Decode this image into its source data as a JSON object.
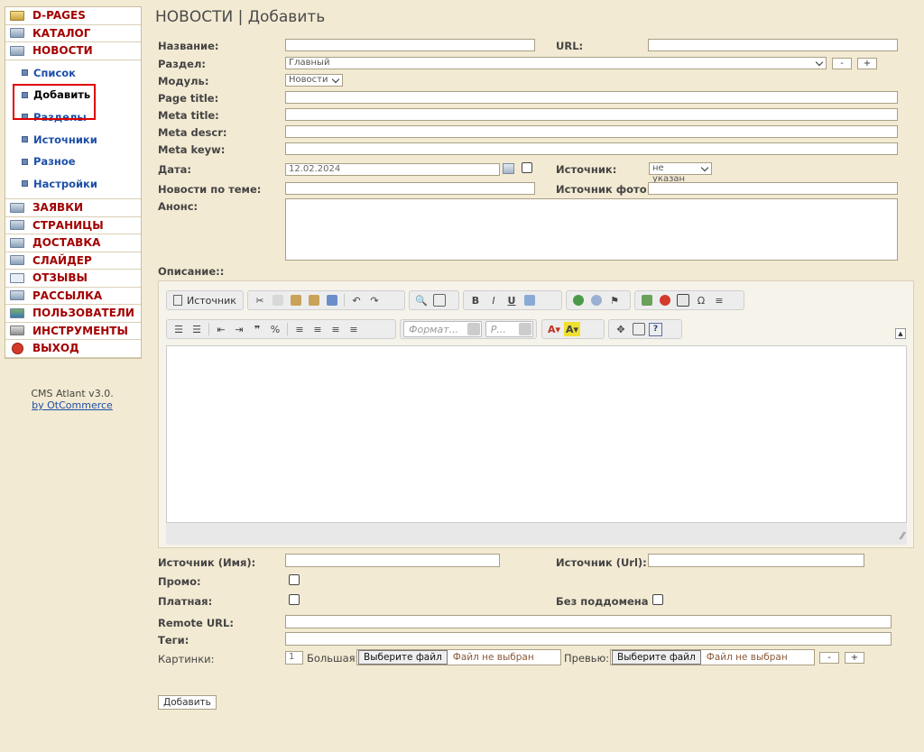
{
  "sidebar": {
    "top_items": [
      {
        "label": "D-PAGES",
        "icon": "pencil-icon"
      },
      {
        "label": "КАТАЛОГ",
        "icon": "box-icon"
      },
      {
        "label": "НОВОСТИ",
        "icon": "newspaper-icon"
      }
    ],
    "sub_items": [
      {
        "label": "Список"
      },
      {
        "label": "Добавить"
      },
      {
        "label": "Разделы"
      },
      {
        "label": "Источники"
      },
      {
        "label": "Разное"
      },
      {
        "label": "Настройки"
      }
    ],
    "bottom_items": [
      {
        "label": "ЗАЯВКИ",
        "icon": "box-icon"
      },
      {
        "label": "СТРАНИЦЫ",
        "icon": "page-icon"
      },
      {
        "label": "ДОСТАВКА",
        "icon": "box-icon"
      },
      {
        "label": "СЛАЙДЕР",
        "icon": "box-icon"
      },
      {
        "label": "ОТЗЫВЫ",
        "icon": "question-icon"
      },
      {
        "label": "РАССЫЛКА",
        "icon": "box-icon"
      },
      {
        "label": "ПОЛЬЗОВАТЕЛИ",
        "icon": "users-icon"
      },
      {
        "label": "ИНСТРУМЕНТЫ",
        "icon": "wrench-icon"
      },
      {
        "label": "ВЫХОД",
        "icon": "exit-icon"
      }
    ],
    "cms_version": "CMS Atlant v3.0.",
    "cms_by": "by OtCommerce"
  },
  "page": {
    "title": "НОВОСТИ | Добавить"
  },
  "form": {
    "name_label": "Название:",
    "url_label": "URL:",
    "section_label": "Раздел:",
    "section_value": "Главный",
    "minus": "-",
    "plus": "+",
    "module_label": "Модуль:",
    "module_value": "Новости",
    "page_title_label": "Page title:",
    "meta_title_label": "Meta title:",
    "meta_descr_label": "Meta descr:",
    "meta_keyw_label": "Meta keyw:",
    "date_label": "Дата:",
    "date_value": "12.02.2024",
    "source_label": "Источник:",
    "source_value": "не указан",
    "related_label": "Новости по теме:",
    "source_photo_label": "Источник фото:",
    "announce_label": "Анонс:",
    "description_label": "Описание::",
    "source_name_label": "Источник (Имя):",
    "source_url_label": "Источник (Url):",
    "promo_label": "Промо:",
    "paid_label": "Платная:",
    "no_subdomain_label": "Без поддомена",
    "remote_url_label": "Remote URL:",
    "tags_label": "Теги:",
    "images_label": "Картинки:",
    "images_count": "1",
    "big_label": "Большая:",
    "preview_label": "Превью:",
    "choose_file": "Выберите файл",
    "no_file": "Файл не выбран",
    "submit": "Добавить"
  },
  "editor": {
    "source_label": "Источник",
    "format_placeholder": "Формат...",
    "size_placeholder": "Р..."
  },
  "colors": {
    "background": "#f2ead2",
    "menu_red": "#a30000",
    "submenu_blue": "#1d4fa8",
    "highlight": "#e00000"
  }
}
